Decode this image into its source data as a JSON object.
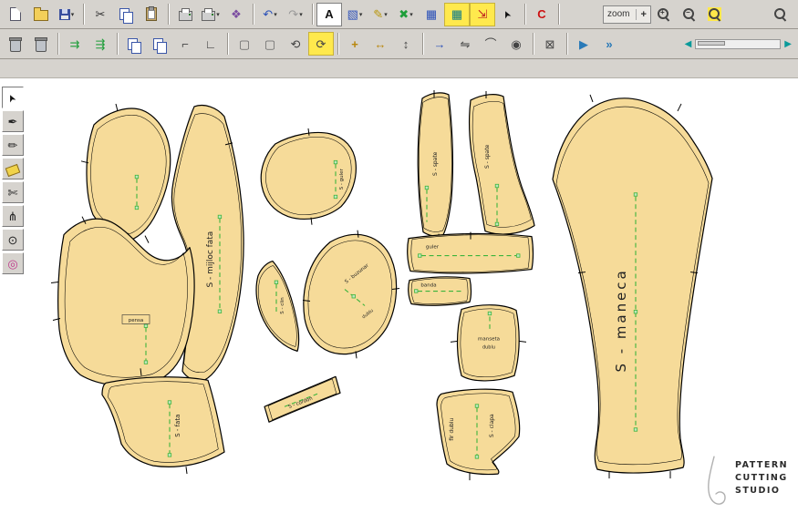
{
  "window": {
    "toolbar_bg": "#d6d3ce",
    "canvas_bg": "#ffffff",
    "piece_fill": "#f6db99",
    "grain_color": "#3cb43c",
    "dropdown_glyph": "▾"
  },
  "toolbar_main": {
    "left_items": [
      {
        "name": "new-button",
        "icon": "page"
      },
      {
        "name": "open-button",
        "icon": "folder"
      },
      {
        "name": "save-button",
        "icon": "floppy",
        "dropdown": true
      },
      {
        "sep": true
      },
      {
        "name": "cut-button",
        "glyph": "✂",
        "color": "#333333"
      },
      {
        "name": "copy-button",
        "icon": "copy"
      },
      {
        "name": "paste-button",
        "icon": "clipboard"
      },
      {
        "sep": true
      },
      {
        "name": "print-button",
        "icon": "printer"
      },
      {
        "name": "plot-button",
        "icon": "printer",
        "dropdown": true
      },
      {
        "name": "export-button",
        "glyph": "❖",
        "color": "#7a4ba0"
      },
      {
        "sep": true
      },
      {
        "name": "undo-button",
        "glyph": "↶",
        "color": "#2a50b8",
        "dropdown": true
      },
      {
        "name": "redo-button",
        "glyph": "↷",
        "color": "#999999",
        "dropdown": true
      },
      {
        "sep": true
      },
      {
        "name": "text-tool-button",
        "glyph": "A",
        "color": "#111111",
        "bold": true,
        "pressed": true
      },
      {
        "name": "frame-tool-button",
        "glyph": "▧",
        "color": "#3355bb",
        "dropdown": true
      },
      {
        "name": "annotate-tool-button",
        "glyph": "✎",
        "color": "#b8960b",
        "dropdown": true
      },
      {
        "name": "delete-annotation-button",
        "glyph": "✖",
        "color": "#1f9e3a",
        "dropdown": true
      },
      {
        "name": "table-view-button",
        "glyph": "▦",
        "color": "#2a50b8"
      },
      {
        "name": "grid-view-button",
        "glyph": "▦",
        "color": "#0a7a8a",
        "highlight": true
      },
      {
        "name": "send-to-plotter-button",
        "glyph": "⇲",
        "color": "#c02020",
        "highlight": true
      },
      {
        "name": "pointer-mode-button",
        "icon": "cursor",
        "glyph": "➤"
      },
      {
        "sep": true
      },
      {
        "name": "regenerate-button",
        "glyph": "C",
        "color": "#cc1111",
        "bold": true
      },
      {
        "sep": true
      }
    ],
    "right_items": [
      {
        "name": "zoom-in-button",
        "icon": "loupe",
        "glyph": "+"
      },
      {
        "name": "zoom-out-button",
        "icon": "loupe",
        "glyph": "−"
      },
      {
        "name": "zoom-all-button",
        "icon": "loupe",
        "glyph": "",
        "iconbg": "#ffe84a"
      }
    ],
    "far_items": [
      {
        "name": "zoom-window-button",
        "icon": "loupe",
        "glyph": ""
      }
    ]
  },
  "zoom": {
    "label": "zoom",
    "plus": "+"
  },
  "toolbar_secondary": {
    "items": [
      {
        "name": "delete-piece-button",
        "icon": "trash"
      },
      {
        "name": "delete-all-button",
        "icon": "trash"
      },
      {
        "sep": true
      },
      {
        "name": "bring-forward-button",
        "glyph": "⇉",
        "color": "#1f9e3a"
      },
      {
        "name": "bring-all-forward-button",
        "glyph": "⇶",
        "color": "#1f9e3a"
      },
      {
        "sep": true
      },
      {
        "name": "merge-pieces-button",
        "icon": "copy"
      },
      {
        "name": "duplicate-piece-button",
        "icon": "copy"
      },
      {
        "name": "corner-tool-button",
        "glyph": "⌐",
        "color": "#444444"
      },
      {
        "name": "stairs-tool-button",
        "glyph": "∟",
        "color": "#444444"
      },
      {
        "sep": true
      },
      {
        "name": "marquee-select-button",
        "glyph": "▢",
        "color": "#666666"
      },
      {
        "name": "marquee-add-button",
        "glyph": "▢",
        "color": "#666666"
      },
      {
        "name": "rotate-ccw-button",
        "glyph": "⟲",
        "color": "#444444"
      },
      {
        "name": "rotate-cw-button",
        "glyph": "⟳",
        "color": "#444444",
        "highlight": true
      },
      {
        "sep": true
      },
      {
        "name": "move-piece-button",
        "glyph": "+",
        "color": "#b8860b",
        "bold": true
      },
      {
        "name": "stretch-piece-button",
        "glyph": "↔",
        "color": "#b8860b"
      },
      {
        "name": "measure-button",
        "glyph": "↕",
        "color": "#444444"
      },
      {
        "sep": true
      },
      {
        "name": "copy-move-button",
        "glyph": "→",
        "color": "#2a50b8"
      },
      {
        "name": "mirror-button",
        "glyph": "⇋",
        "color": "#444444"
      },
      {
        "name": "arc-tool-button",
        "glyph": "⌒",
        "color": "#444444"
      },
      {
        "name": "pivot-button",
        "glyph": "◉",
        "color": "#444444"
      },
      {
        "sep": true
      },
      {
        "name": "close-pattern-button",
        "glyph": "⊠",
        "color": "#444444"
      },
      {
        "sep": true
      },
      {
        "name": "walk-piece-button",
        "glyph": "▶",
        "color": "#2a7ab8"
      },
      {
        "name": "walk-all-button",
        "glyph": "»",
        "color": "#2a7ab8",
        "bold": true
      }
    ]
  },
  "nav": {
    "left": "◀",
    "right": "▶"
  },
  "tools_left": {
    "items": [
      {
        "name": "select-tool",
        "icon": "cursor",
        "glyph": "➤",
        "pressed": true
      },
      {
        "name": "curve-pen-tool",
        "glyph": "✒",
        "color": "#222222"
      },
      {
        "name": "pencil-tool",
        "glyph": "✏",
        "color": "#222222"
      },
      {
        "name": "eraser-tool",
        "icon": "eraser"
      },
      {
        "name": "knife-tool",
        "glyph": "✄",
        "color": "#222222"
      },
      {
        "name": "notch-tool",
        "glyph": "⋔",
        "color": "#222222"
      },
      {
        "name": "drill-tool",
        "glyph": "⊙",
        "color": "#222222"
      },
      {
        "name": "tracing-wheel-tool",
        "glyph": "◎",
        "color": "#c03a8c"
      }
    ]
  },
  "canvas": {
    "pieces": [
      {
        "name": "front-side-panel",
        "label": ""
      },
      {
        "name": "center-front-panel",
        "label": "S - mijloc fata"
      },
      {
        "name": "side-panel",
        "label": "pensa"
      },
      {
        "name": "collar-piece",
        "label": "S - guler"
      },
      {
        "name": "gusset-piece",
        "label": "S - clin"
      },
      {
        "name": "pocket-piece",
        "label": "S - buzunar",
        "label2": "dublu"
      },
      {
        "name": "belt-piece",
        "label": "S - cordon"
      },
      {
        "name": "front-piece",
        "label": "S - fata"
      },
      {
        "name": "back-side-panel",
        "label": "S - spate"
      },
      {
        "name": "back-panel",
        "label": "S - spate"
      },
      {
        "name": "collar-band-piece",
        "label": "guler"
      },
      {
        "name": "band-piece",
        "label": "banda"
      },
      {
        "name": "cuff-piece",
        "label": "manseta",
        "label2": "dublu"
      },
      {
        "name": "flap-piece",
        "label": "fir dublu",
        "label2": "S - clapa"
      },
      {
        "name": "sleeve-piece",
        "label": "S - maneca"
      }
    ]
  },
  "logo": {
    "line1": "PATTERN",
    "line2": "CUTTING",
    "line3": "STUDIO"
  }
}
